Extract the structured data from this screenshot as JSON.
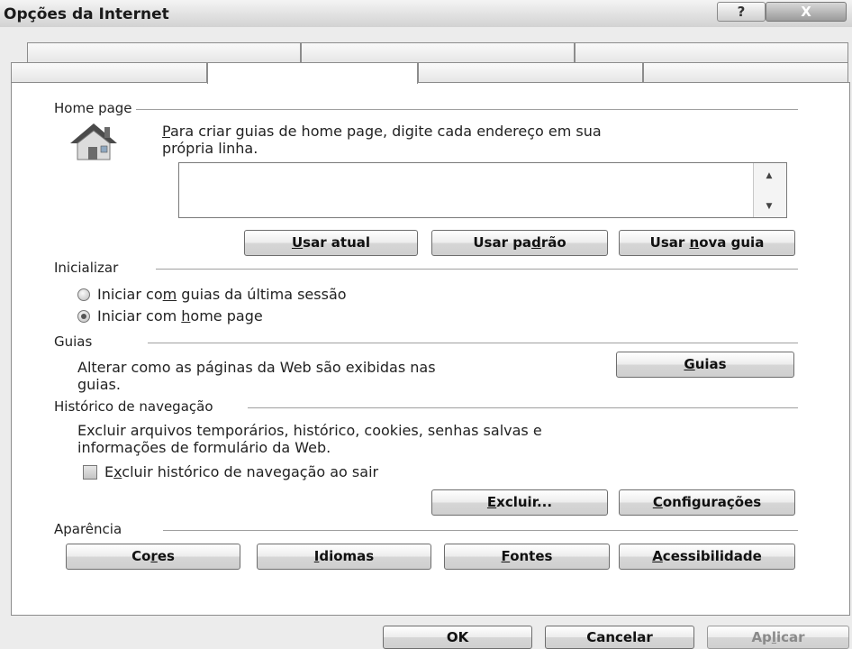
{
  "window": {
    "title": "Opções da Internet",
    "help_label": "?",
    "close_label": "X"
  },
  "home_page": {
    "section_label": "Home page",
    "description_line1_access": "P",
    "description_line1_rest": "ara criar guias de home page, digite cada endereço em sua",
    "description_line2": "própria linha.",
    "textarea_value": "",
    "use_current_access": "U",
    "use_current_rest": "sar atual",
    "use_default_pre": "Usar pa",
    "use_default_access": "d",
    "use_default_post": "rão",
    "use_new_tab_pre": "Usar ",
    "use_new_tab_access": "n",
    "use_new_tab_post": "ova guia"
  },
  "startup": {
    "section_label": "Inicializar",
    "option1_pre": "Iniciar co",
    "option1_access": "m",
    "option1_post": " guias da última sessão",
    "option2_pre": "Iniciar com ",
    "option2_access": "h",
    "option2_post": "ome page",
    "selected": "option2"
  },
  "tabs_section": {
    "section_label": "Guias",
    "description_line1": "Alterar como as páginas da Web são exibidas nas",
    "description_line2": "guias.",
    "button_access": "G",
    "button_rest": "uias"
  },
  "history": {
    "section_label": "Histórico de navegação",
    "description_line1": "Excluir arquivos temporários, histórico, cookies, senhas salvas e",
    "description_line2": "informações de formulário da Web.",
    "checkbox_pre": "E",
    "checkbox_access": "x",
    "checkbox_post": "cluir histórico de navegação ao sair",
    "checkbox_checked": false,
    "delete_access": "E",
    "delete_rest": "xcluir...",
    "settings_access": "C",
    "settings_rest": "onfigurações"
  },
  "appearance": {
    "section_label": "Aparência",
    "colors_pre": "Co",
    "colors_access": "r",
    "colors_post": "es",
    "languages_access": "I",
    "languages_rest": "diomas",
    "fonts_access": "F",
    "fonts_rest": "ontes",
    "accessibility_access": "A",
    "accessibility_rest": "cessibilidade"
  },
  "footer": {
    "ok_label": "OK",
    "cancel_label": "Cancelar",
    "apply_pre": "Ap",
    "apply_access": "l",
    "apply_post": "icar"
  },
  "colors": {
    "panel_bg": "#ffffff",
    "window_bg": "#ececec",
    "border": "#8c8c8c",
    "house_roof": "#4a4a4a",
    "house_wall": "#dcdcdc"
  }
}
